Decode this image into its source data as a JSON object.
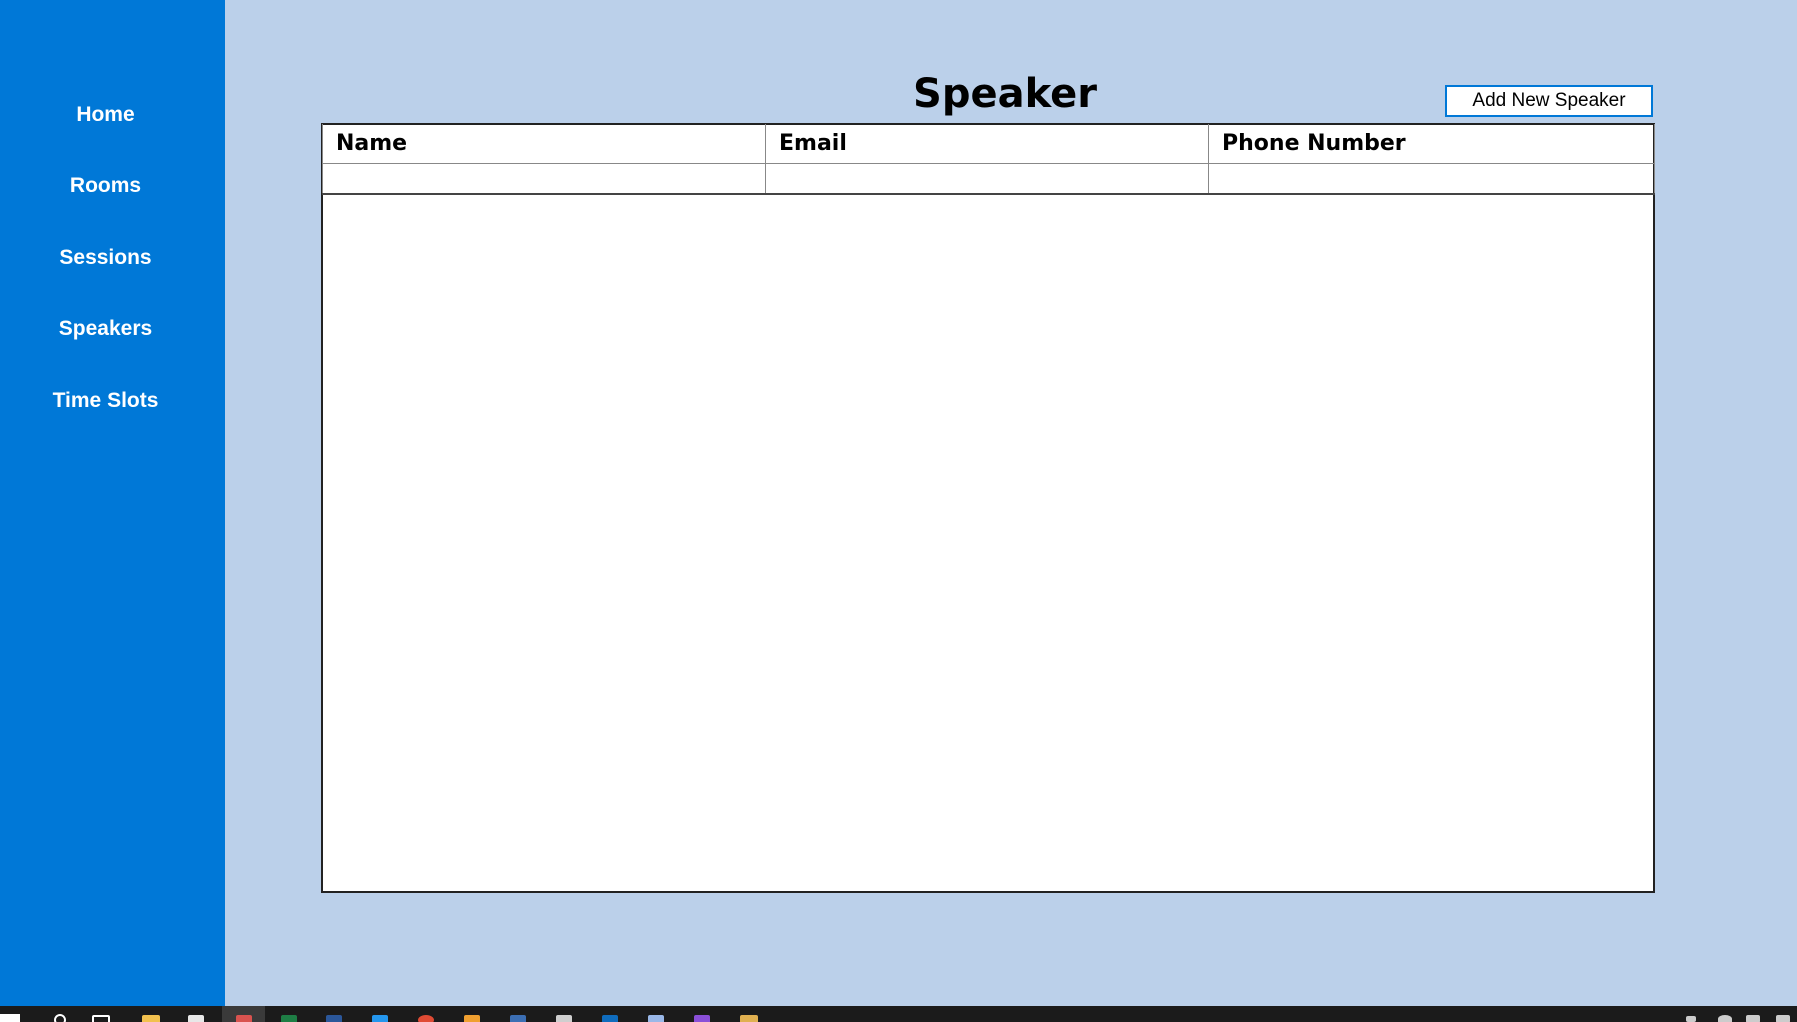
{
  "sidebar": {
    "items": [
      {
        "label": "Home"
      },
      {
        "label": "Rooms"
      },
      {
        "label": "Sessions"
      },
      {
        "label": "Speakers"
      },
      {
        "label": "Time Slots"
      }
    ]
  },
  "main": {
    "title": "Speaker",
    "add_button_label": "Add New Speaker",
    "table": {
      "columns": [
        "Name",
        "Email",
        "Phone Number"
      ],
      "rows": [
        [
          "",
          "",
          ""
        ]
      ]
    }
  },
  "colors": {
    "sidebar_bg": "#0078d7",
    "page_bg": "#bbd0ea",
    "accent": "#0078d7",
    "taskbar_bg": "#1b1b1b"
  },
  "taskbar": {
    "icons": [
      "windows-start-icon",
      "search-icon",
      "task-view-icon",
      "file-explorer-icon",
      "notepad-icon",
      "app-active-icon",
      "excel-icon",
      "word-icon",
      "vscode-icon",
      "chrome-icon",
      "paint-icon",
      "visual-studio-code-icon",
      "terminal-icon",
      "outlook-icon",
      "notes-icon",
      "visual-studio-icon",
      "folder-app-icon"
    ]
  }
}
